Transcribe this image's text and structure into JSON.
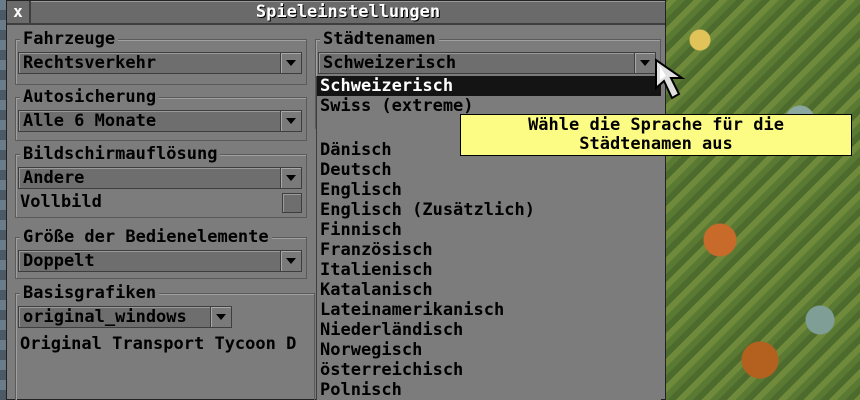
{
  "window": {
    "title": "Spieleinstellungen",
    "close_label": "x"
  },
  "groups": {
    "vehicles": {
      "label": "Fahrzeuge",
      "value": "Rechtsverkehr"
    },
    "autosave": {
      "label": "Autosicherung",
      "value": "Alle 6 Monate"
    },
    "resolution": {
      "label": "Bildschirmauflösung",
      "value": "Andere",
      "fullscreen_label": "Vollbild"
    },
    "ui_size": {
      "label": "Größe der Bedienelemente",
      "value": "Doppelt"
    },
    "base_graphics": {
      "label": "Basisgrafiken",
      "value": "original_windows",
      "description": "Original Transport Tycoon D"
    },
    "town_names": {
      "label": "Städtenamen",
      "value": "Schweizerisch"
    }
  },
  "town_names_list": {
    "top_items": [
      "Schweizerisch",
      "Swiss (extreme)"
    ],
    "items": [
      "Dänisch",
      "Deutsch",
      "Englisch",
      "Englisch (Zusätzlich)",
      "Finnisch",
      "Französisch",
      "Italienisch",
      "Katalanisch",
      "Lateinamerikanisch",
      "Niederländisch",
      "Norwegisch",
      "österreichisch",
      "Polnisch"
    ],
    "selected_index": 0
  },
  "tooltip": {
    "line1": "Wähle die Sprache für die",
    "line2": "Städtenamen aus"
  },
  "icons": {
    "close": "close-icon",
    "dropdown": "chevron-down-icon",
    "cursor": "arrow-cursor-icon"
  },
  "colors": {
    "window_bg": "#7c7c7c",
    "selection_bg": "#141414",
    "tooltip_bg": "#fcfc84"
  }
}
